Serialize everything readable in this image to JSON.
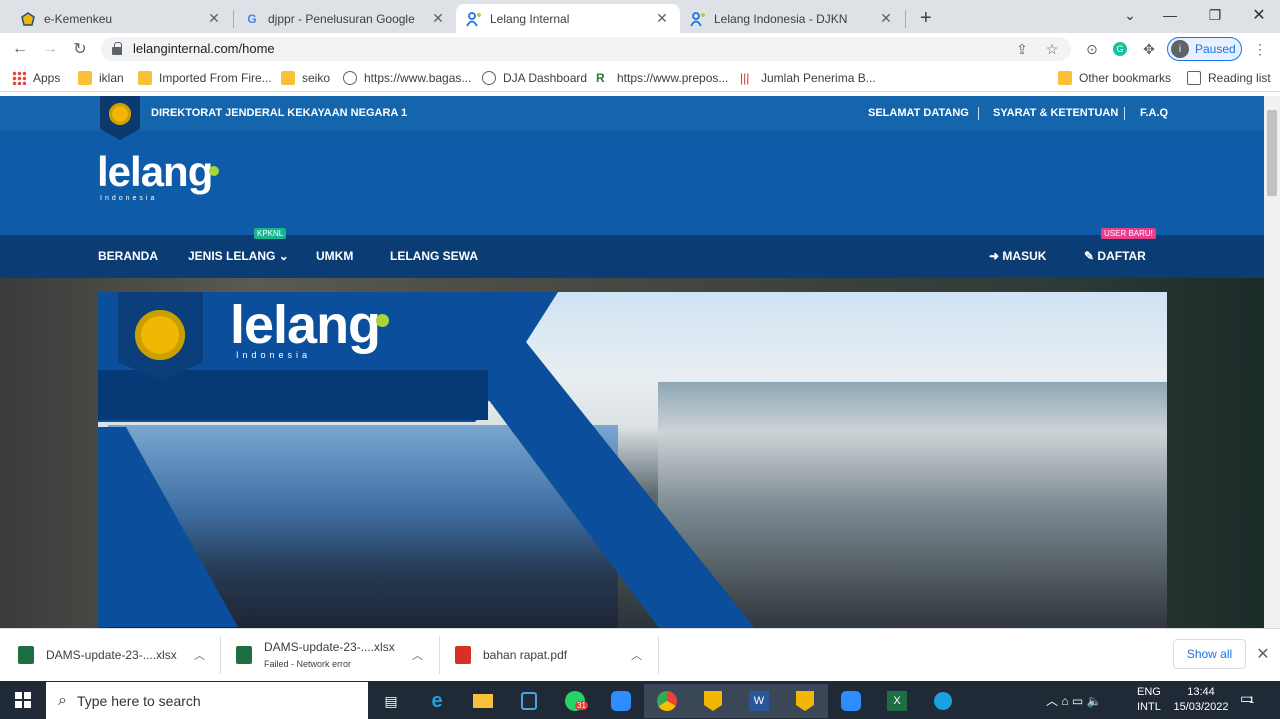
{
  "browser": {
    "tabs": [
      {
        "title": "e-Kemenkeu",
        "icon": "kemenkeu-icon",
        "active": false
      },
      {
        "title": "djppr - Penelusuran Google",
        "icon": "google-icon",
        "active": false
      },
      {
        "title": "Lelang Internal",
        "icon": "lelang-icon",
        "active": true
      },
      {
        "title": "Lelang Indonesia - DJKN",
        "icon": "lelang-icon",
        "active": false
      }
    ],
    "new_tab": "+",
    "url": "lelanginternal.com/home",
    "profile_status": "Paused",
    "profile_initial": "i",
    "bookmarks": [
      {
        "label": "Apps",
        "icon": "apps-icon"
      },
      {
        "label": "iklan",
        "icon": "folder-icon"
      },
      {
        "label": "Imported From Fire...",
        "icon": "folder-icon"
      },
      {
        "label": "seiko",
        "icon": "folder-icon"
      },
      {
        "label": "https://www.bagas...",
        "icon": "globe-icon"
      },
      {
        "label": "DJA Dashboard",
        "icon": "globe-icon"
      },
      {
        "label": "https://www.prepos...",
        "icon": "prepos-icon"
      },
      {
        "label": "Jumlah Penerima B...",
        "icon": "chart-icon"
      }
    ],
    "other_bookmarks": "Other bookmarks",
    "reading_list": "Reading list"
  },
  "site": {
    "org_name": "DIREKTORAT JENDERAL KEKAYAAN NEGARA 1",
    "top_links": [
      "SELAMAT DATANG",
      "SYARAT & KETENTUAN",
      "F.A.Q"
    ],
    "logo_text": "lelang",
    "logo_sub": "Indonesia",
    "menu": {
      "beranda": "BERANDA",
      "jenis_lelang": "JENIS LELANG",
      "jenis_badge": "KPKNL",
      "umkm": "UMKM",
      "lelang_sewa": "LELANG SEWA",
      "masuk": "MASUK",
      "daftar": "DAFTAR",
      "daftar_badge": "USER BARU!"
    },
    "hero_logo_text": "lelang",
    "hero_logo_sub": "Indonesia"
  },
  "downloads": [
    {
      "name": "DAMS-update-23-....xlsx",
      "status": "",
      "type": "excel"
    },
    {
      "name": "DAMS-update-23-....xlsx",
      "status": "Failed - Network error",
      "type": "excel"
    },
    {
      "name": "bahan rapat.pdf",
      "status": "",
      "type": "pdf"
    }
  ],
  "show_all": "Show all",
  "taskbar": {
    "search_placeholder": "Type here to search",
    "whatsapp_badge": "31",
    "lang": "ENG",
    "layout": "INTL",
    "time": "13:44",
    "date": "15/03/2022",
    "notif_count": "1"
  }
}
